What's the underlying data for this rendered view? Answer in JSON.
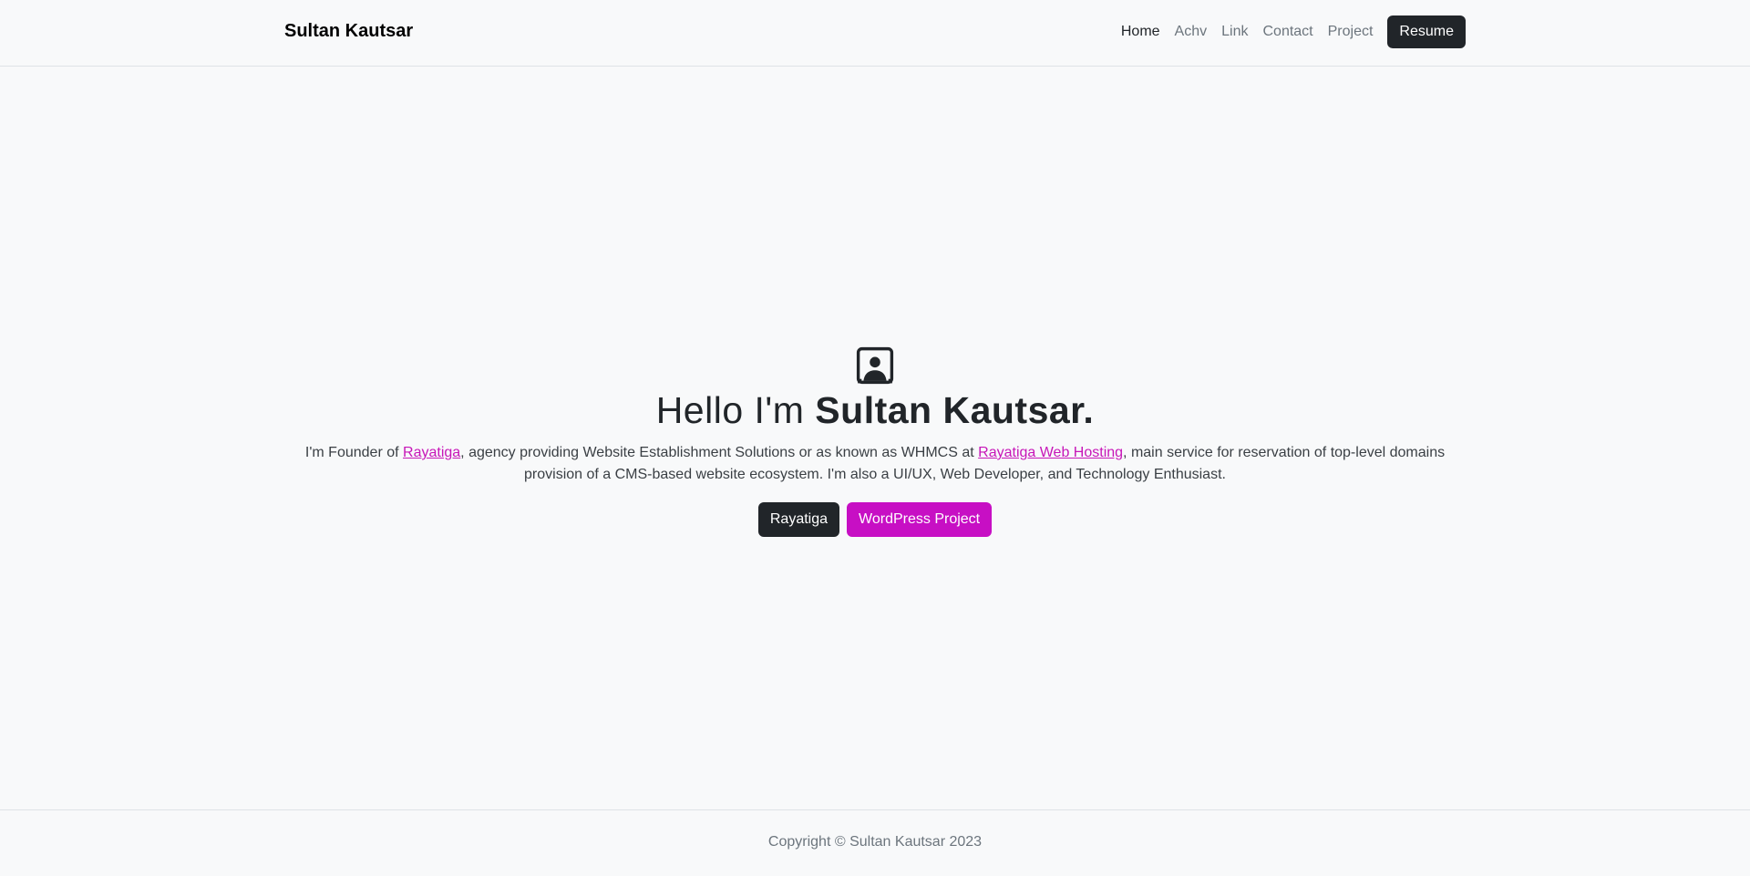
{
  "navbar": {
    "brand": "Sultan Kautsar",
    "links": [
      "Home",
      "Achv",
      "Link",
      "Contact",
      "Project"
    ],
    "resume_label": "Resume"
  },
  "hero": {
    "icon": "person-video-icon",
    "title_prefix": "Hello I'm ",
    "title_name": "Sultan Kautsar.",
    "text_part1": "I'm Founder of ",
    "link1": "Rayatiga",
    "text_part2": ", agency providing Website Establishment Solutions or as known as WHMCS at ",
    "link2": "Rayatiga Web Hosting",
    "text_part3": ", main service for reservation of top-level domains provision of a CMS-based website ecosystem. I'm also a UI/UX, Web Developer, and Technology Enthusiast.",
    "button_primary": "Rayatiga",
    "button_secondary": "WordPress Project"
  },
  "footer": {
    "copyright": "Copyright © Sultan Kautsar 2023"
  },
  "colors": {
    "accent": "#c70fc4",
    "dark": "#212529",
    "background": "#f8f9fa"
  }
}
